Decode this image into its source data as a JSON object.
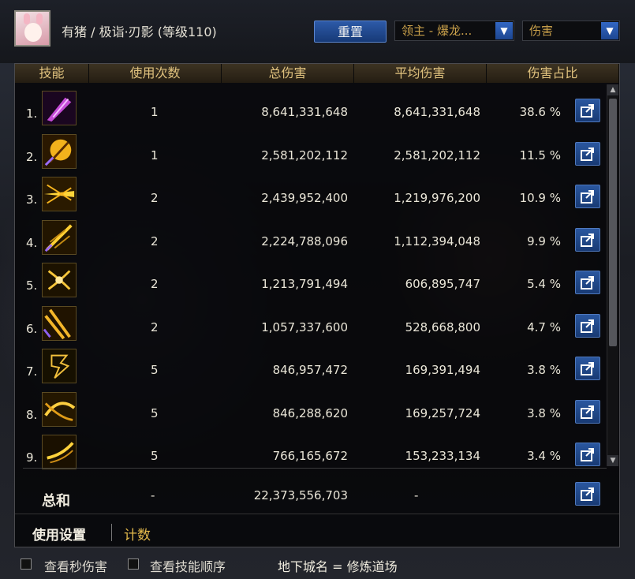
{
  "header": {
    "player": "有猪 / 极诣·刃影 (等级110)",
    "reset_label": "重置",
    "target_select": "领主 - 爆龙...",
    "mode_select": "伤害"
  },
  "columns": [
    "技能",
    "使用次数",
    "总伤害",
    "平均伤害",
    "伤害占比"
  ],
  "rows": [
    {
      "rank": "1.",
      "uses": "1",
      "total": "8,641,331,648",
      "avg": "8,641,331,648",
      "pct": "38.6 %"
    },
    {
      "rank": "2.",
      "uses": "1",
      "total": "2,581,202,112",
      "avg": "2,581,202,112",
      "pct": "11.5 %"
    },
    {
      "rank": "3.",
      "uses": "2",
      "total": "2,439,952,400",
      "avg": "1,219,976,200",
      "pct": "10.9 %"
    },
    {
      "rank": "4.",
      "uses": "2",
      "total": "2,224,788,096",
      "avg": "1,112,394,048",
      "pct": "9.9 %"
    },
    {
      "rank": "5.",
      "uses": "2",
      "total": "1,213,791,494",
      "avg": "606,895,747",
      "pct": "5.4 %"
    },
    {
      "rank": "6.",
      "uses": "2",
      "total": "1,057,337,600",
      "avg": "528,668,800",
      "pct": "4.7 %"
    },
    {
      "rank": "7.",
      "uses": "5",
      "total": "846,957,472",
      "avg": "169,391,494",
      "pct": "3.8 %"
    },
    {
      "rank": "8.",
      "uses": "5",
      "total": "846,288,620",
      "avg": "169,257,724",
      "pct": "3.8 %"
    },
    {
      "rank": "9.",
      "uses": "5",
      "total": "766,165,672",
      "avg": "153,233,134",
      "pct": "3.4 %"
    }
  ],
  "summary": {
    "label": "总和",
    "uses": "-",
    "total": "22,373,556,703",
    "avg": "-"
  },
  "tabs": {
    "settings": "使用设置",
    "count": "计数"
  },
  "footer": {
    "show_dps": "查看秒伤害",
    "show_order": "查看技能顺序",
    "dungeon": "地下城名 = 修炼道场"
  },
  "colors": {
    "accent_gold": "#e5bb4c",
    "button_blue": "#2a579f"
  }
}
